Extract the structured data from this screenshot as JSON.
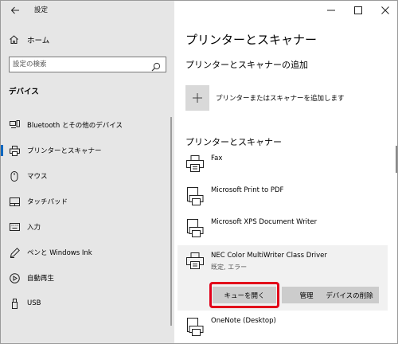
{
  "app": {
    "title": "設定"
  },
  "sidebar": {
    "home_label": "ホーム",
    "search_placeholder": "設定の検索",
    "section_heading": "デバイス",
    "items": [
      {
        "label": "Bluetooth とその他のデバイス",
        "icon": "bluetooth-devices-icon",
        "active": false
      },
      {
        "label": "プリンターとスキャナー",
        "icon": "printer-icon",
        "active": true
      },
      {
        "label": "マウス",
        "icon": "mouse-icon",
        "active": false
      },
      {
        "label": "タッチパッド",
        "icon": "touchpad-icon",
        "active": false
      },
      {
        "label": "入力",
        "icon": "keyboard-icon",
        "active": false
      },
      {
        "label": "ペンと Windows Ink",
        "icon": "pen-icon",
        "active": false
      },
      {
        "label": "自動再生",
        "icon": "autoplay-icon",
        "active": false
      },
      {
        "label": "USB",
        "icon": "usb-icon",
        "active": false
      }
    ]
  },
  "main": {
    "title": "プリンターとスキャナー",
    "add_section_heading": "プリンターとスキャナーの追加",
    "add_button_label": "プリンターまたはスキャナーを追加します",
    "list_heading": "プリンターとスキャナー",
    "printers": [
      {
        "name": "Fax",
        "status": "",
        "icon": "fax-icon"
      },
      {
        "name": "Microsoft Print to PDF",
        "status": "",
        "icon": "printer-doc-icon"
      },
      {
        "name": "Microsoft XPS Document Writer",
        "status": "",
        "icon": "printer-doc-icon"
      },
      {
        "name": "NEC Color MultiWriter Class Driver",
        "status": "既定, エラー",
        "icon": "printer-icon"
      },
      {
        "name": "OneNote (Desktop)",
        "status": "",
        "icon": "printer-doc-icon"
      }
    ],
    "actions": {
      "open_queue": "キューを開く",
      "manage": "管理",
      "remove_device": "デバイスの削除"
    }
  },
  "colors": {
    "sidebar_bg": "#e6e6e6",
    "accent": "#0067c0",
    "highlight_box": "#e2001a",
    "button_bg": "#cccccc"
  }
}
